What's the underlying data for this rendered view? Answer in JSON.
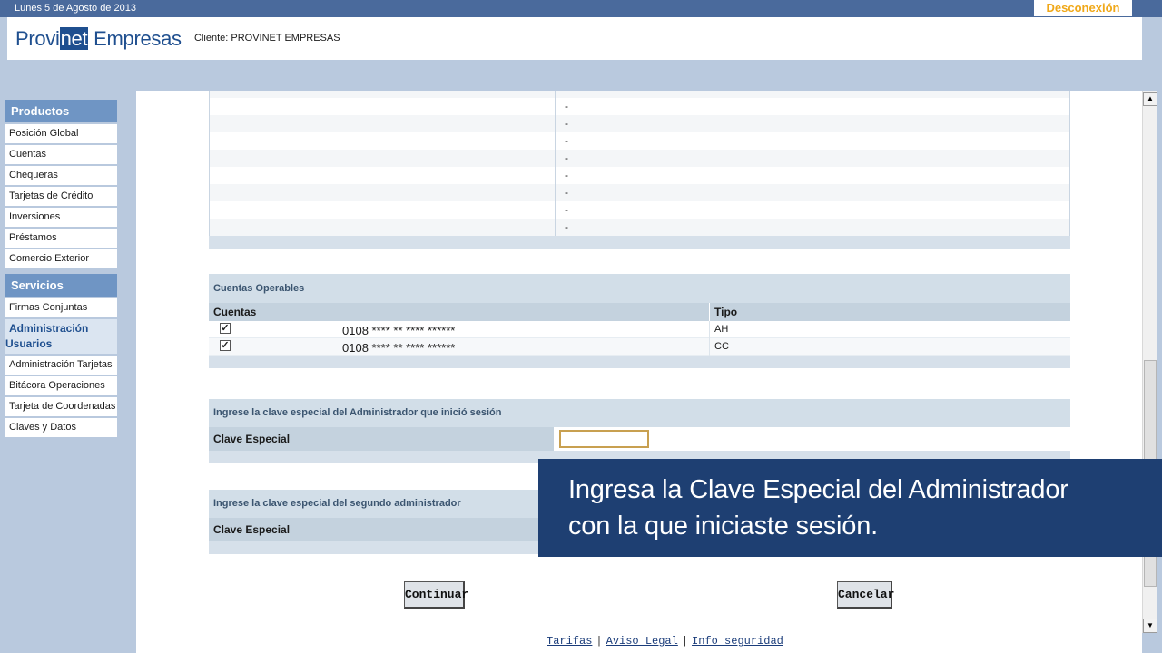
{
  "header": {
    "date": "Lunes 5 de Agosto de 2013",
    "logout_label": "Desconexión",
    "logo": {
      "pre": "Provi",
      "highlight": "net",
      "post": " Empresas"
    },
    "client_label": "Cliente: PROVINET EMPRESAS"
  },
  "sidebar": {
    "productos": {
      "title": "Productos",
      "items": [
        "Posición Global",
        "Cuentas",
        "Chequeras",
        "Tarjetas de Crédito",
        "Inversiones",
        "Préstamos",
        "Comercio Exterior"
      ]
    },
    "servicios": {
      "title": "Servicios",
      "item_firmas": "Firmas Conjuntas",
      "sub_line1": "Administración",
      "sub_line2": "Usuarios",
      "items": [
        "Administración Tarjetas",
        "Bitácora Operaciones",
        "Tarjeta de Coordenadas",
        "Claves y Datos"
      ]
    }
  },
  "upper_table": {
    "values": [
      "-",
      "-",
      "-",
      "-",
      "-",
      "-",
      "-",
      "-"
    ]
  },
  "cuentas_operables": {
    "title": "Cuentas Operables",
    "col_cuentas": "Cuentas",
    "col_tipo": "Tipo",
    "rows": [
      {
        "checked": "✓",
        "account": "0108 **** ** **** ******",
        "tipo": "AH"
      },
      {
        "checked": "✓",
        "account": "0108 **** ** **** ******",
        "tipo": "CC"
      }
    ]
  },
  "clave_admin": {
    "title": "Ingrese la clave especial del Administrador que inició sesión",
    "label": "Clave Especial",
    "value": ""
  },
  "clave_segundo": {
    "title": "Ingrese la clave especial del segundo administrador",
    "label": "Clave Especial"
  },
  "buttons": {
    "continuar": "Continuar",
    "cancelar": "Cancelar"
  },
  "footer": {
    "tarifas": "Tarifas",
    "aviso": "Aviso Legal",
    "info": "Info seguridad",
    "separator": "|"
  },
  "scrollbar": {
    "up_glyph": "▲",
    "down_glyph": "▼"
  },
  "caption": {
    "line1": "Ingresa la Clave Especial del Administrador",
    "line2": "con la que iniciaste sesión."
  },
  "colors": {
    "topbar": "#4a6a9c",
    "brand_blue": "#1f4f8f",
    "logout_orange": "#f0a818",
    "sidebar_head": "#6f95c4",
    "caption_bg": "#1e3f72"
  }
}
